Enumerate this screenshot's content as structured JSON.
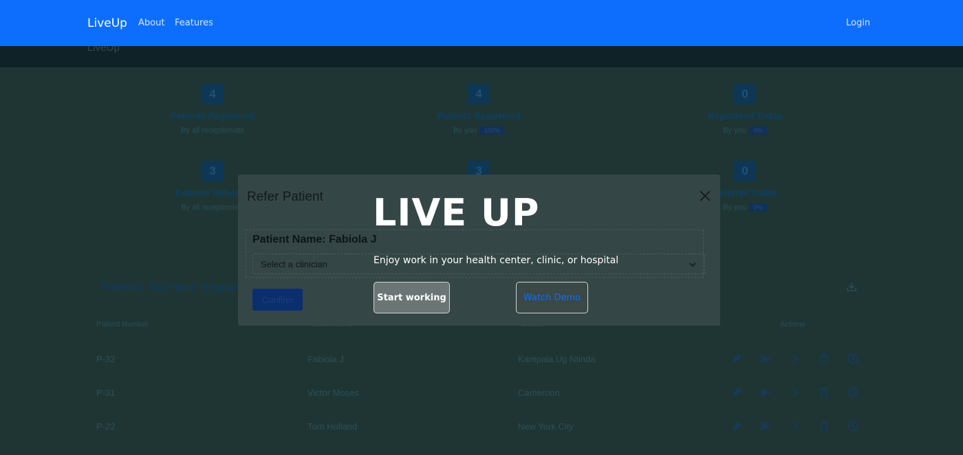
{
  "navbar": {
    "brand": "LiveUp",
    "links": [
      "About",
      "Features"
    ],
    "login": "Login",
    "color": "#0d6efd"
  },
  "background": {
    "brand": "LiveUp",
    "stats": [
      {
        "value": "4",
        "title": "Patients Registered",
        "sub": "By all receptionists",
        "badge": ""
      },
      {
        "value": "4",
        "title": "Patients Registered",
        "sub": "By you",
        "badge": "100%"
      },
      {
        "value": "0",
        "title": "Registered Today",
        "sub": "By you",
        "badge": "0%"
      },
      {
        "value": "3",
        "title": "Patients Referred",
        "sub": "By all receptionists",
        "badge": ""
      },
      {
        "value": "3",
        "title": "",
        "sub": "",
        "badge": ""
      },
      {
        "value": "0",
        "title": "Referred Today",
        "sub": "By you",
        "badge": "0%"
      }
    ],
    "section_title": "Patients You Have Registered",
    "table": {
      "headers": [
        "Patient Number",
        "Patient Name",
        "Address",
        "Actions"
      ],
      "rows": [
        {
          "number": "P-32",
          "name": "Fabiola J",
          "address": "Kampala Ug Ntinda"
        },
        {
          "number": "P-31",
          "name": "Victor Moses",
          "address": "Cameroon"
        },
        {
          "number": "P-22",
          "name": "Tom Holland",
          "address": "New York City"
        }
      ]
    }
  },
  "modal": {
    "title": "Refer Patient",
    "patient_label": "Patient Name: Fabiola J",
    "select_placeholder": "Select a clinician",
    "confirm": "Confirm"
  },
  "hero": {
    "title": "LIVE UP",
    "subtitle": "Enjoy work in your health center, clinic, or hospital",
    "start_label": "Start working",
    "demo_label": "Watch Demo"
  }
}
